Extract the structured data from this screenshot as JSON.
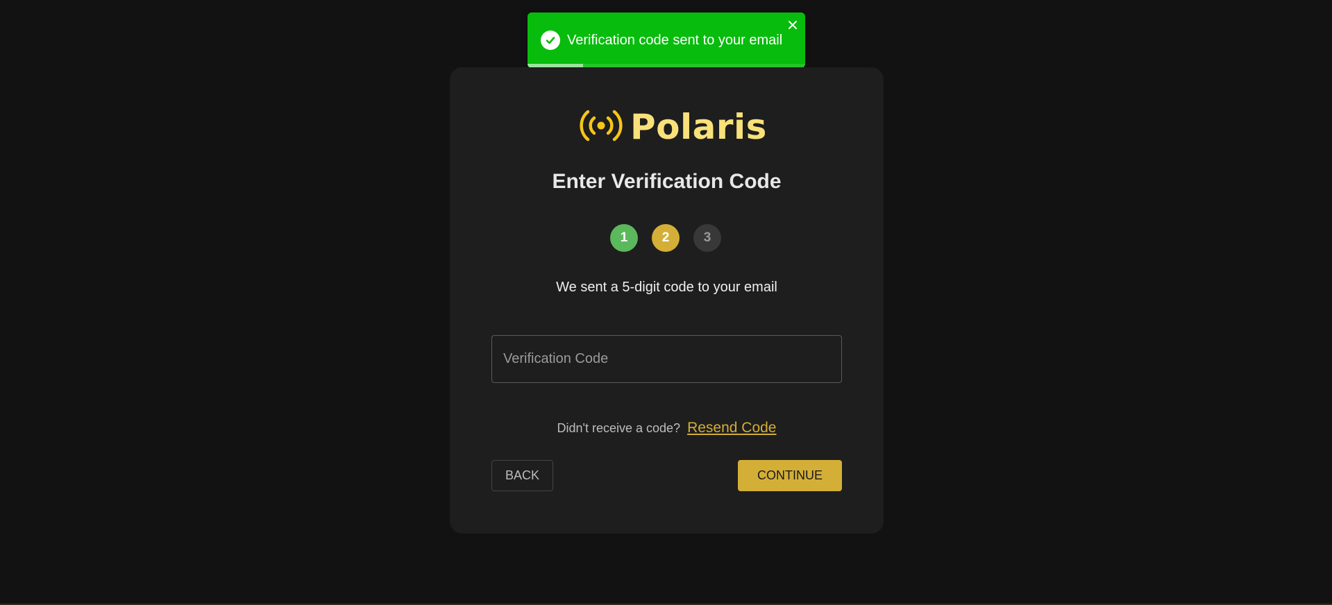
{
  "toast": {
    "message": "Verification code sent to your email",
    "status": "success",
    "color": "#07bc0c",
    "icon": "check-circle-icon",
    "close_icon": "close-icon",
    "progress_fraction": 0.2
  },
  "brand": {
    "name": "Polaris",
    "icon": "broadcast-icon",
    "color": "#f9e17a",
    "icon_color": "#f5c518"
  },
  "card": {
    "title": "Enter Verification Code",
    "steps": [
      {
        "label": "1",
        "state": "done",
        "color": "#5cb85c"
      },
      {
        "label": "2",
        "state": "active",
        "color": "#d4af37"
      },
      {
        "label": "3",
        "state": "pending",
        "color": "#383838"
      }
    ],
    "subtitle": "We sent a 5-digit code to your email",
    "code_input": {
      "value": "",
      "placeholder": "Verification Code"
    },
    "resend": {
      "question": "Didn't receive a code?",
      "link": "Resend Code"
    },
    "back_label": "BACK",
    "continue_label": "CONTINUE",
    "accent_color": "#d4af37"
  }
}
